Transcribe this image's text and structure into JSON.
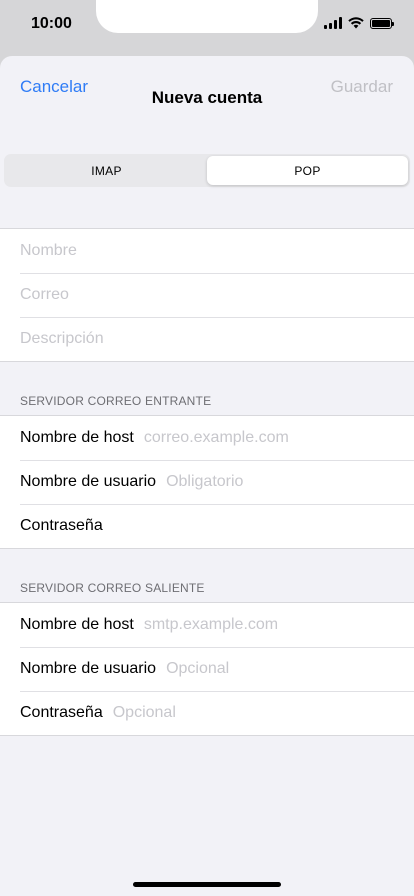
{
  "status_bar": {
    "time": "10:00"
  },
  "nav": {
    "cancel": "Cancelar",
    "title": "Nueva cuenta",
    "save": "Guardar"
  },
  "segments": [
    "IMAP",
    "POP"
  ],
  "selected_segment": "POP",
  "account": {
    "name_label": "Nombre",
    "email_label": "Correo",
    "description_label": "Descripción"
  },
  "incoming": {
    "header": "SERVIDOR CORREO ENTRANTE",
    "host_label": "Nombre de host",
    "host_placeholder": "correo.example.com",
    "user_label": "Nombre de usuario",
    "user_placeholder": "Obligatorio",
    "password_label": "Contraseña"
  },
  "outgoing": {
    "header": "SERVIDOR CORREO SALIENTE",
    "host_label": "Nombre de host",
    "host_placeholder": "smtp.example.com",
    "user_label": "Nombre de usuario",
    "user_placeholder": "Opcional",
    "password_label": "Contraseña",
    "password_placeholder": "Opcional"
  },
  "colors": {
    "accent": "#2f7cf6",
    "disabled": "#c0c0c5",
    "background": "#f2f2f7"
  }
}
